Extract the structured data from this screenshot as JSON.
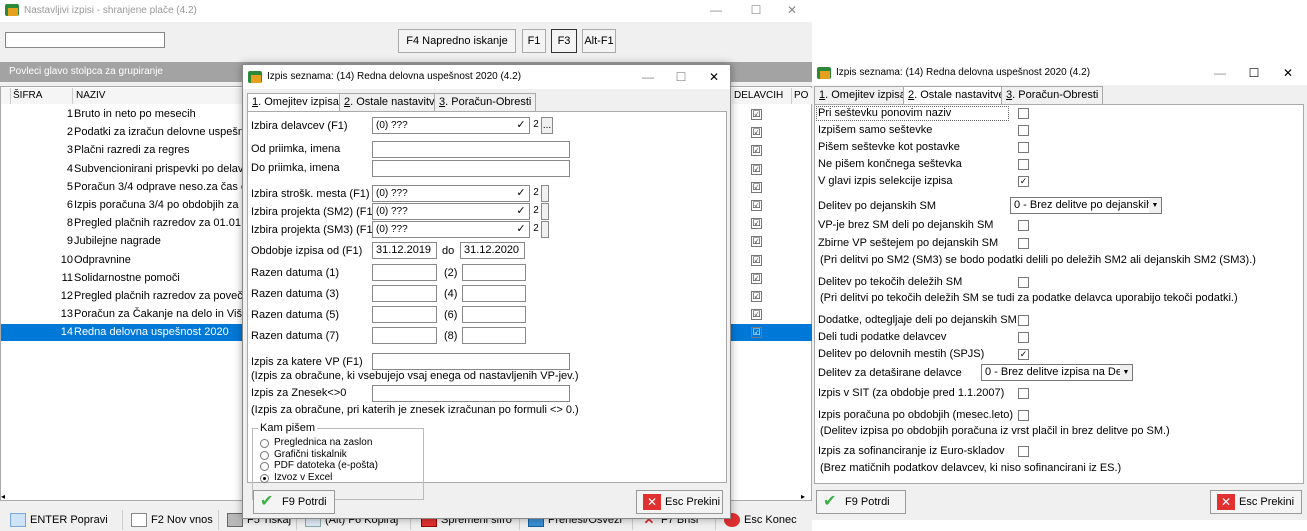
{
  "bg": {
    "title": "Nastavljivi izpisi - shranjene plače (4.2)",
    "search_value": "",
    "toolbar": {
      "adv_search": "F4  Napredno iskanje",
      "f1": "F1",
      "f3": "F3",
      "altf1": "Alt-F1"
    },
    "group_hint": "Povleci glavo stolpca za grupiranje",
    "columns": {
      "sifra": "ŠIFRA",
      "naziv": "NAZIV",
      "delavcih": "DELAVCIH",
      "po": "PO"
    },
    "rows": [
      {
        "num": "1",
        "name": "Bruto in neto po mesecih",
        "checked": "☑"
      },
      {
        "num": "2",
        "name": "Podatki za izračun delovne uspešno",
        "checked": "☑"
      },
      {
        "num": "3",
        "name": "Plačni razredi za regres",
        "checked": "☑"
      },
      {
        "num": "4",
        "name": "Subvencionirani prispevki po delavcih",
        "checked": "☑"
      },
      {
        "num": "5",
        "name": "Poračun 3/4 odprave neso.za čas od",
        "checked": "☑"
      },
      {
        "num": "6",
        "name": "Izpis poračuna 3/4 po obdobjih za M",
        "checked": "☑"
      },
      {
        "num": "8",
        "name": "Pregled plačnih razredov za 01.01.20",
        "checked": "☑"
      },
      {
        "num": "9",
        "name": "Jubilejne nagrade",
        "checked": "☑"
      },
      {
        "num": "10",
        "name": "Odpravnine",
        "checked": "☑"
      },
      {
        "num": "11",
        "name": "Solidarnostne pomoči",
        "checked": "☑"
      },
      {
        "num": "12",
        "name": "Pregled plačnih razredov za povečan",
        "checked": "☑"
      },
      {
        "num": "13",
        "name": "Poračun za Čakanje na delo in Višjo",
        "checked": "☑"
      },
      {
        "num": "14",
        "name": "Redna delovna uspešnost 2020",
        "checked": "☑"
      }
    ],
    "bottom": {
      "enter": "ENTER Popravi",
      "f2": "F2 Nov vnos",
      "f5": "F5 Tiskaj",
      "f6": "(Alt) F6 Kopiraj",
      "sifra": "Spremeni šifro",
      "prenesi": "Prenesi/Osveži",
      "f7": "F7 Briši",
      "esc": "Esc Konec"
    }
  },
  "dlg1": {
    "title": "Izpis seznama: (14)  Redna delovna uspešnost 2020  (4.2)",
    "tabs": [
      "1. Omejitev izpisa",
      "2. Ostale nastavitve",
      "3. Poračun-Obresti"
    ],
    "tab_nums": [
      "1",
      "2",
      "3"
    ],
    "tab_texts": [
      ". Omejitev izpisa",
      ". Ostale nastavitve",
      ". Poračun-Obresti"
    ],
    "izbira_delavcev": {
      "label": "Izbira delavcev (F1)",
      "value": "(0) ???"
    },
    "od_priimka": "Od priimka, imena",
    "do_priimka": "Do priimka, imena",
    "strosk": {
      "label": "Izbira strošk. mesta (F1)",
      "value": "(0) ???"
    },
    "proj2": {
      "label": "Izbira projekta (SM2) (F1)",
      "value": "(0) ???"
    },
    "proj3": {
      "label": "Izbira projekta (SM3) (F1)",
      "value": "(0) ???"
    },
    "mini_check": "✓",
    "mini_two": "2",
    "mini_dots": "...",
    "obdobje": {
      "label": "Obdobje izpisa od (F1)",
      "from": "31.12.2019",
      "do": "do",
      "to": "31.12.2020"
    },
    "razen": [
      {
        "label": "Razen datuma (1)",
        "n": "(2)"
      },
      {
        "label": "Razen datuma (3)",
        "n": "(4)"
      },
      {
        "label": "Razen datuma (5)",
        "n": "(6)"
      },
      {
        "label": "Razen datuma (7)",
        "n": "(8)"
      }
    ],
    "katere_vp": "Izpis za katere VP (F1)",
    "katere_vp_note": "(Izpis za obračune, ki vsebujejo vsaj enega od nastavljenih VP-jev.)",
    "znesek": "Izpis za Znesek<>0",
    "znesek_note": "(Izpis za obračune, pri katerih je znesek izračunan po formuli <> 0.)",
    "kam": {
      "legend": "Kam pišem",
      "options": [
        "Preglednica na zaslon",
        "Grafični tiskalnik",
        "PDF datoteka (e-pošta)",
        "Izvoz v Excel"
      ],
      "selected": 3
    },
    "ok": "F9 Potrdi",
    "cancel": "Esc Prekini"
  },
  "dlg2": {
    "title": "Izpis seznama: (14)  Redna delovna uspešnost 2020  (4.2)",
    "tabs": [
      "1. Omejitev izpisa",
      "2. Ostale nastavitve",
      "3. Poračun-Obresti"
    ],
    "opts": [
      {
        "label": "Pri seštevku ponovim naziv",
        "checked": ""
      },
      {
        "label": "Izpišem samo seštevke",
        "checked": ""
      },
      {
        "label": "Pišem seštevke kot postavke",
        "checked": ""
      },
      {
        "label": "Ne pišem končnega seštevka",
        "checked": ""
      },
      {
        "label": "V glavi izpis selekcije izpisa",
        "checked": "✓"
      }
    ],
    "delitev_sm": {
      "label": "Delitev po dejanskih SM",
      "value": "0 - Brez delitve po dejanskih SM"
    },
    "vp_brez": {
      "label": "VP-je brez SM deli po dejanskih SM",
      "checked": ""
    },
    "zbirne": {
      "label": "Zbirne VP seštejem po dejanskih SM",
      "checked": ""
    },
    "zbirne_note": "(Pri delitvi po SM2 (SM3) se bodo podatki delili po deležih SM2 ali dejanskih SM2 (SM3).)",
    "tekocih": {
      "label": "Delitev po tekočih deležih SM",
      "checked": ""
    },
    "tekocih_note": "(Pri delitvi po tekočih deležih SM se tudi za podatke delavca uporabijo tekoči podatki.)",
    "dodatke": {
      "label": "Dodatke, odtegljaje deli po dejanskih SM",
      "checked": ""
    },
    "deli_tudi": {
      "label": "Deli tudi podatke delavcev",
      "checked": ""
    },
    "delovnih": {
      "label": "Delitev po delovnih mestih (SPJS)",
      "checked": "✓"
    },
    "detasirane": {
      "label": "Delitev za detaširane delavce",
      "value": "0 - Brez delitve izpisa na Delo-Ti"
    },
    "sit": {
      "label": "Izpis v SIT (za obdobje pred 1.1.2007)",
      "checked": ""
    },
    "obdobjih": {
      "label": "Izpis poračuna po obdobjih (mesec.leto)",
      "checked": ""
    },
    "obdobjih_note": "(Delitev izpisa po obdobjih poračuna iz vrst plačil in brez delitve po SM.)",
    "euro": {
      "label": "Izpis za sofinanciranje iz Euro-skladov",
      "checked": ""
    },
    "euro_note": "(Brez matičnih podatkov delavcev, ki niso sofinancirani iz ES.)",
    "ok": "F9 Potrdi",
    "cancel": "Esc Prekini"
  },
  "window_controls": {
    "min": "—",
    "max": "☐",
    "close": "✕"
  },
  "colors": {
    "selection": "#0078d7",
    "group_bar": "#a3a3a3",
    "ok_green": "#3cb043",
    "cancel_red": "#e03030"
  }
}
